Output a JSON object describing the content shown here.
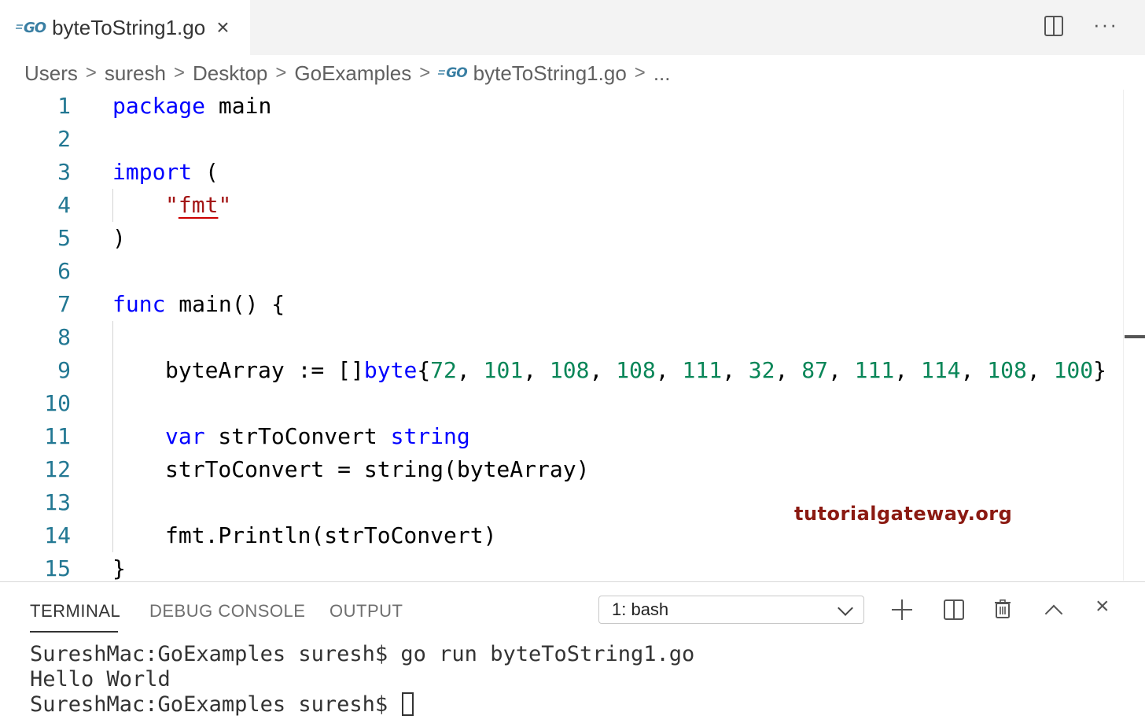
{
  "tab": {
    "logo": "GO",
    "title": "byteToString1.go",
    "close": "×"
  },
  "editor_actions": {
    "split": "split-editor-icon",
    "more": "···"
  },
  "breadcrumb": {
    "items": [
      "Users",
      "suresh",
      "Desktop",
      "GoExamples"
    ],
    "file_logo": "GO",
    "file": "byteToString1.go",
    "tail": "...",
    "separator": ">"
  },
  "code": {
    "line_numbers": [
      "1",
      "2",
      "3",
      "4",
      "5",
      "6",
      "7",
      "8",
      "9",
      "10",
      "11",
      "12",
      "13",
      "14",
      "15"
    ],
    "tokens": {
      "l1_kw": "package",
      "l1_rest": " main",
      "l3_kw": "import",
      "l3_rest": " (",
      "l4_q1": "\"",
      "l4_str": "fmt",
      "l4_q2": "\"",
      "l5": ")",
      "l7_kw": "func",
      "l7_rest": " main() {",
      "l9_a": "byteArray := []",
      "l9_type": "byte",
      "l9_brace": "{",
      "l9_nums": [
        "72",
        "101",
        "108",
        "108",
        "111",
        "32",
        "87",
        "111",
        "114",
        "108",
        "100"
      ],
      "l9_sep": ", ",
      "l9_end": "}",
      "l11_kw": "var",
      "l11_mid": " strToConvert ",
      "l11_type": "string",
      "l12": "strToConvert = string(byteArray)",
      "l14": "fmt.Println(strToConvert)",
      "l15": "}"
    }
  },
  "watermark": "tutorialgateway.org",
  "panel": {
    "tabs": [
      "TERMINAL",
      "DEBUG CONSOLE",
      "OUTPUT"
    ],
    "terminal_select": "1: bash",
    "output": [
      "SureshMac:GoExamples suresh$ go run byteToString1.go",
      "Hello World",
      "SureshMac:GoExamples suresh$ "
    ],
    "close": "×"
  },
  "colors": {
    "keyword": "#0000ff",
    "number": "#098658",
    "string": "#a31515",
    "line_number": "#237893"
  }
}
